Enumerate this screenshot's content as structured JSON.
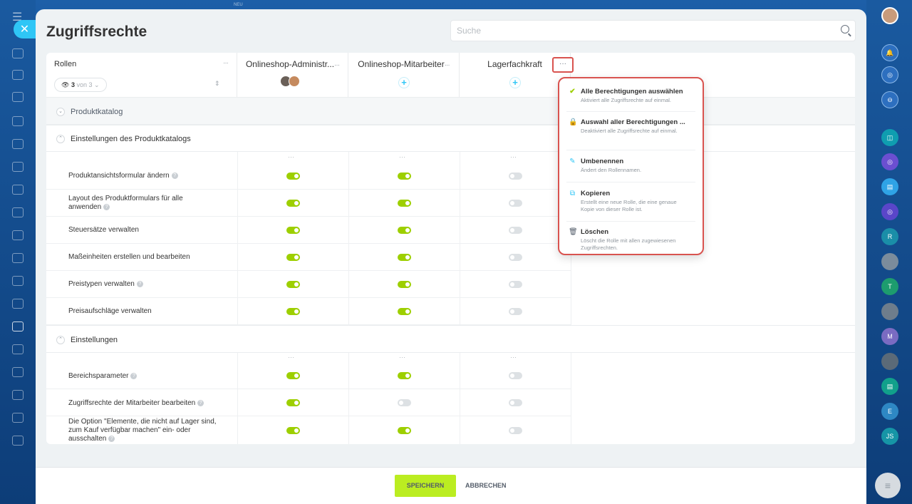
{
  "page_title": "Zugriffsrechte",
  "search": {
    "placeholder": "Suche"
  },
  "columns": {
    "roles_label": "Rollen",
    "filter_count": "3",
    "filter_of": "von 3",
    "role1": "Onlineshop-Administr...",
    "role2": "Onlineshop-Mitarbeiter",
    "role3": "Lagerfachkraft"
  },
  "sections": [
    {
      "title": "Produktkatalog"
    },
    {
      "title": "Einstellungen des Produktkatalogs"
    },
    {
      "title": "Einstellungen"
    }
  ],
  "rows": [
    {
      "label": "Produktansichtsformular ändern",
      "help": true,
      "values": [
        true,
        true,
        false
      ]
    },
    {
      "label": "Layout des Produktformulars für alle anwenden",
      "help": true,
      "values": [
        true,
        true,
        false
      ]
    },
    {
      "label": "Steuersätze verwalten",
      "help": false,
      "values": [
        true,
        true,
        false
      ]
    },
    {
      "label": "Maßeinheiten erstellen und bearbeiten",
      "help": false,
      "values": [
        true,
        true,
        false
      ]
    },
    {
      "label": "Preistypen verwalten",
      "help": true,
      "values": [
        true,
        true,
        false
      ]
    },
    {
      "label": "Preisaufschläge verwalten",
      "help": false,
      "values": [
        true,
        true,
        false
      ]
    },
    {
      "label": "Bereichsparameter",
      "help": true,
      "values": [
        true,
        true,
        false
      ]
    },
    {
      "label": "Zugriffsrechte der Mitarbeiter bearbeiten",
      "help": true,
      "values": [
        true,
        false,
        false
      ]
    },
    {
      "label": "Die Option \"Elemente, die nicht auf Lager sind, zum Kauf verfügbar machen\" ein- oder ausschalten",
      "help": true,
      "values": [
        true,
        true,
        false
      ]
    }
  ],
  "menu": [
    {
      "title": "Alle Berechtigungen auswählen",
      "desc": "Aktiviert alle Zugriffsrechte auf einmal.",
      "icon": "check-icon",
      "color": "#9dcf00"
    },
    {
      "title": "Auswahl aller Berechtigungen ...",
      "desc": "Deaktiviert alle Zugriffsrechte auf einmal.",
      "icon": "lock-icon",
      "color": "#e8474c"
    },
    {
      "title": "Umbenennen",
      "desc": "Ändert den Rollennamen.",
      "icon": "pencil-icon",
      "color": "#2fc6f6"
    },
    {
      "title": "Kopieren",
      "desc": "Erstellt eine neue Rolle, die eine genaue Kopie von dieser Rolle ist.",
      "icon": "copy-icon",
      "color": "#2fc6f6"
    },
    {
      "title": "Löschen",
      "desc": "Löscht die Rolle mit allen zugewiesenen Zugriffsrechten.",
      "icon": "trash-icon",
      "color": "#525c69"
    }
  ],
  "footer": {
    "save": "SPEICHERN",
    "cancel": "ABBRECHEN"
  },
  "left_badge": "NEU",
  "rightbar_letters": [
    "R",
    "T",
    "M",
    "E",
    "JS"
  ],
  "colors": {
    "toggle_on": "#9dcf00",
    "accent": "#2fc6f6",
    "save": "#bbed21",
    "highlight": "#d9534f"
  }
}
